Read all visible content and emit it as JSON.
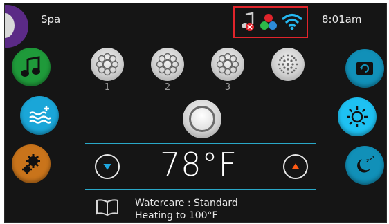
{
  "header": {
    "title": "Spa",
    "time": "8:01am"
  },
  "status_icons": [
    {
      "icon": "music-muted-icon"
    },
    {
      "icon": "color-dots-icon"
    },
    {
      "icon": "wifi-icon"
    }
  ],
  "jets": [
    {
      "label": "1"
    },
    {
      "label": "2"
    },
    {
      "label": "3"
    },
    {
      "label": ""
    }
  ],
  "temperature": {
    "value": "78°F"
  },
  "status": {
    "line1": "Watercare : Standard",
    "line2": "Heating to 100°F"
  },
  "colors": {
    "accent": "#2aa8c8",
    "music": "#1f9a3a",
    "spa": "#1aa6d8",
    "settings": "#c9741b",
    "down_arrow": "#1ea7e0",
    "up_arrow": "#ff5a14",
    "status_frame": "#e0242b"
  }
}
